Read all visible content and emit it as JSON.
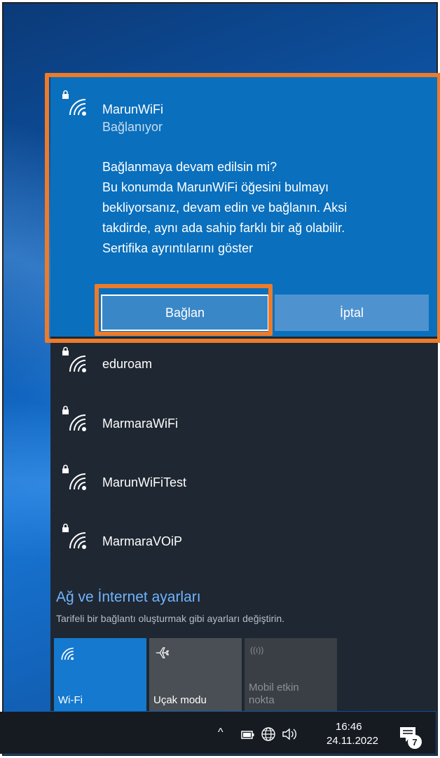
{
  "selected_network": {
    "name": "MarunWiFi",
    "status": "Bağlanıyor",
    "message_lines": [
      "Bağlanmaya devam edilsin mi?",
      "Bu konumda MarunWiFi öğesini bulmayı",
      "bekliyorsanız, devam edin ve bağlanın. Aksi",
      "takdirde, aynı ada sahip farklı bir ağ olabilir."
    ],
    "cert_link": "Sertifika ayrıntılarını göster",
    "connect_label": "Bağlan",
    "cancel_label": "İptal"
  },
  "networks": [
    {
      "name": "eduroam"
    },
    {
      "name": "MarmaraWiFi"
    },
    {
      "name": "MarunWiFiTest"
    },
    {
      "name": "MarmaraVOiP"
    }
  ],
  "settings": {
    "title": "Ağ ve İnternet ayarları",
    "subtitle": "Tarifeli bir bağlantı oluşturmak gibi ayarları değiştirin."
  },
  "quick_actions": [
    {
      "label": "Wi-Fi",
      "icon": "wifi-icon",
      "active": true
    },
    {
      "label": "Uçak modu",
      "icon": "airplane-icon",
      "active": false
    },
    {
      "label": "Mobil etkin\nnokta",
      "icon": "hotspot-icon",
      "active": false
    }
  ],
  "taskbar": {
    "time": "16:46",
    "date": "24.11.2022",
    "notification_count": "7"
  },
  "colors": {
    "accent": "#0a6fbd",
    "highlight": "#ec7b2a",
    "panel": "#1f2732",
    "link": "#6fb4ff"
  }
}
